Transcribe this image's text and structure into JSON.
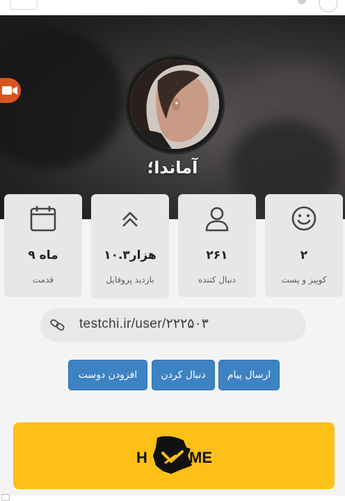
{
  "profile": {
    "name": "آماندا؛"
  },
  "stats": [
    {
      "icon": "smiley-icon",
      "value": "۲",
      "label": "کوییز و پست"
    },
    {
      "icon": "user-icon",
      "value": "۲۶۱",
      "label": "دنبال کننده"
    },
    {
      "icon": "double-chevron-up-icon",
      "value": "۱۰.۳هزار",
      "label": "بازدید پروفایل"
    },
    {
      "icon": "calendar-icon",
      "value": "۹ ماه",
      "label": "قدمت"
    }
  ],
  "link": {
    "url": "testchi.ir/user/۲۲۲۵۰۳"
  },
  "actions": {
    "send_message": "ارسال پیام",
    "follow": "دنبال کردن",
    "add_friend": "افزودن دوست"
  },
  "banner": {
    "logo_text": "HOME"
  },
  "colors": {
    "accent_blue": "#3d83c3",
    "banner_yellow": "#fdc017",
    "video_orange": "#d9551f",
    "card_bg": "#e7e7e7"
  }
}
